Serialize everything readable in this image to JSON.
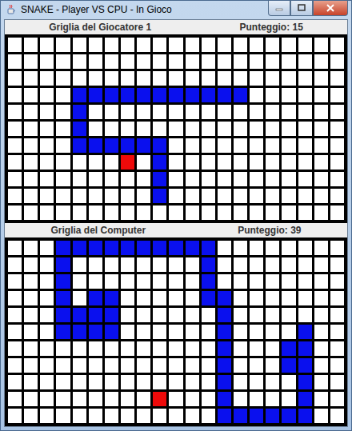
{
  "window": {
    "title": "SNAKE - Player VS CPU - In Gioco"
  },
  "grids": [
    {
      "label": "Griglia del Giocatore 1",
      "score": "Punteggio: 15",
      "rows": 11,
      "cols": 21,
      "snake": [
        [
          3,
          4
        ],
        [
          3,
          5
        ],
        [
          3,
          6
        ],
        [
          3,
          7
        ],
        [
          3,
          8
        ],
        [
          3,
          9
        ],
        [
          3,
          10
        ],
        [
          3,
          11
        ],
        [
          3,
          12
        ],
        [
          3,
          13
        ],
        [
          3,
          14
        ],
        [
          4,
          4
        ],
        [
          5,
          4
        ],
        [
          6,
          4
        ],
        [
          6,
          5
        ],
        [
          6,
          6
        ],
        [
          6,
          7
        ],
        [
          6,
          8
        ],
        [
          6,
          9
        ],
        [
          7,
          9
        ],
        [
          8,
          9
        ],
        [
          9,
          9
        ]
      ],
      "food": [
        7,
        7
      ]
    },
    {
      "label": "Griglia del Computer",
      "score": "Punteggio: 39",
      "rows": 11,
      "cols": 21,
      "snake": [
        [
          0,
          3
        ],
        [
          0,
          4
        ],
        [
          0,
          5
        ],
        [
          0,
          6
        ],
        [
          0,
          7
        ],
        [
          0,
          8
        ],
        [
          0,
          9
        ],
        [
          0,
          10
        ],
        [
          0,
          11
        ],
        [
          0,
          12
        ],
        [
          1,
          3
        ],
        [
          1,
          12
        ],
        [
          2,
          3
        ],
        [
          2,
          12
        ],
        [
          3,
          3
        ],
        [
          3,
          5
        ],
        [
          3,
          6
        ],
        [
          3,
          12
        ],
        [
          3,
          13
        ],
        [
          4,
          3
        ],
        [
          4,
          4
        ],
        [
          4,
          5
        ],
        [
          4,
          6
        ],
        [
          4,
          13
        ],
        [
          5,
          3
        ],
        [
          5,
          4
        ],
        [
          5,
          5
        ],
        [
          5,
          6
        ],
        [
          5,
          13
        ],
        [
          5,
          18
        ],
        [
          6,
          13
        ],
        [
          6,
          17
        ],
        [
          6,
          18
        ],
        [
          7,
          13
        ],
        [
          7,
          17
        ],
        [
          7,
          18
        ],
        [
          8,
          13
        ],
        [
          8,
          18
        ],
        [
          9,
          13
        ],
        [
          9,
          18
        ],
        [
          10,
          13
        ],
        [
          10,
          14
        ],
        [
          10,
          15
        ],
        [
          10,
          16
        ],
        [
          10,
          17
        ],
        [
          10,
          18
        ]
      ],
      "food": [
        9,
        9
      ]
    }
  ]
}
